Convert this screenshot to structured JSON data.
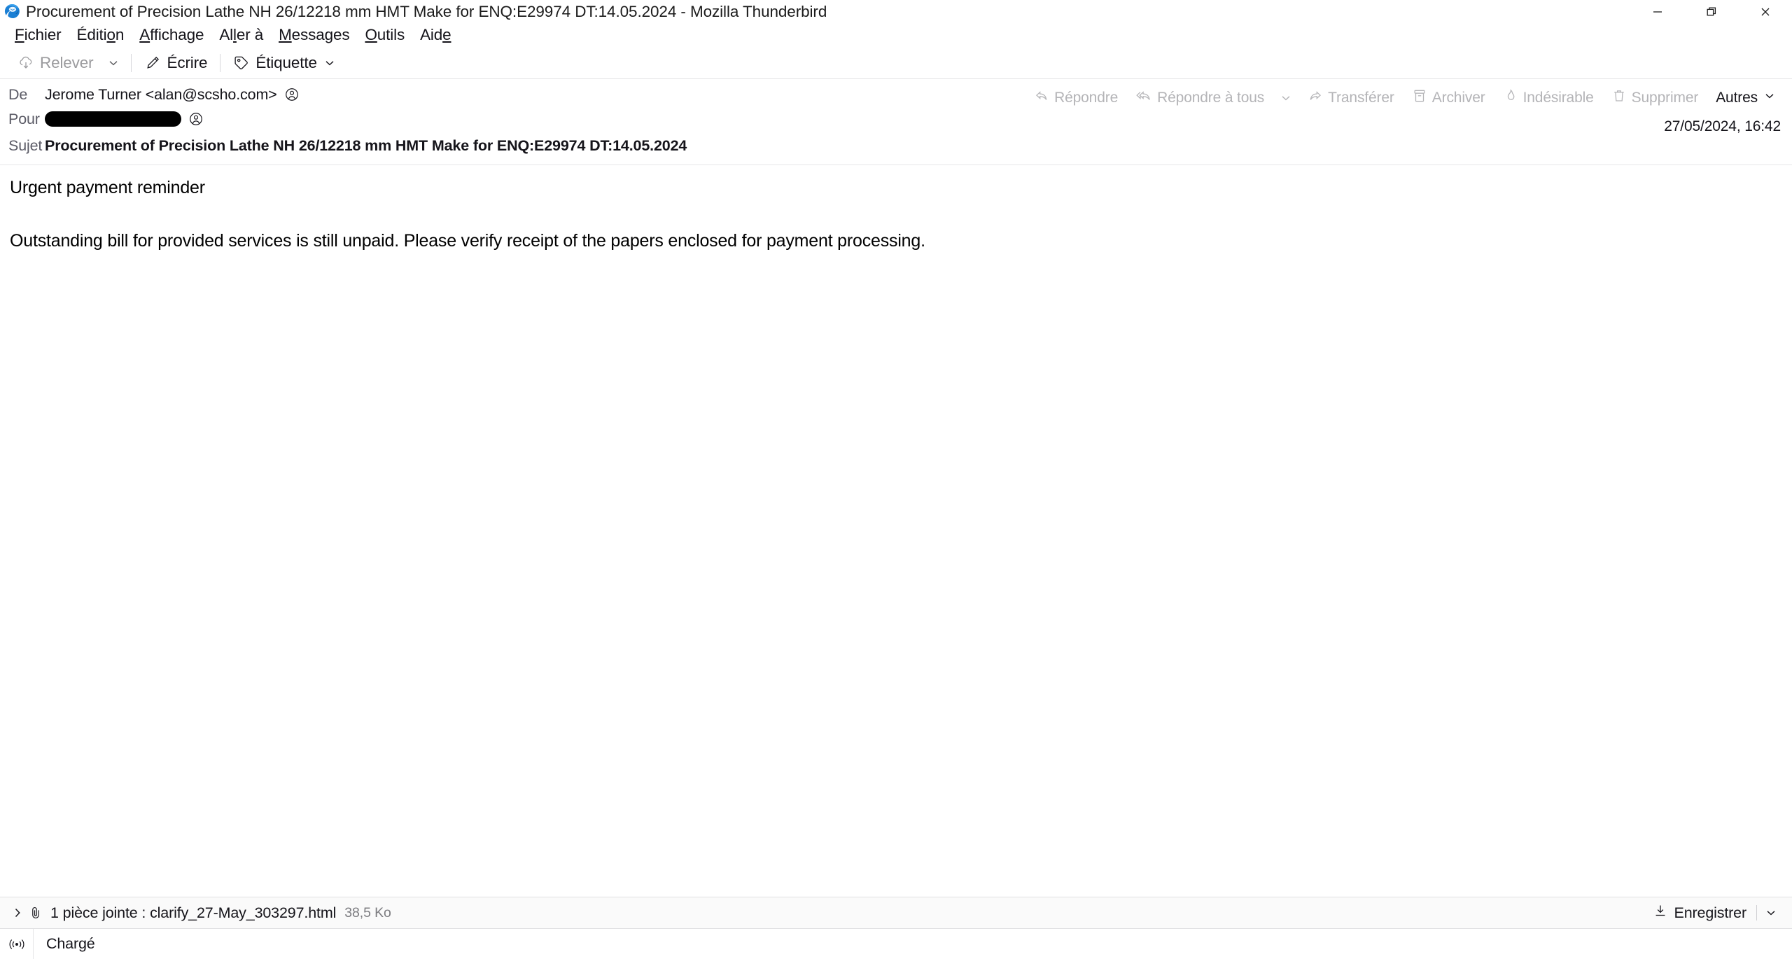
{
  "window": {
    "title": "Procurement of Precision Lathe NH 26/12218 mm HMT Make for ENQ:E29974 DT:14.05.2024 - Mozilla Thunderbird",
    "app_icon": "thunderbird-logo",
    "controls": {
      "minimize": "minimize-icon",
      "restore": "restore-icon",
      "close": "close-icon"
    }
  },
  "menubar": {
    "items": [
      {
        "label": "Fichier",
        "accel_index": 0
      },
      {
        "label": "Édition",
        "accel_index": 4
      },
      {
        "label": "Affichage",
        "accel_index": 0
      },
      {
        "label": "Aller à",
        "accel_index": 2
      },
      {
        "label": "Messages",
        "accel_index": 0
      },
      {
        "label": "Outils",
        "accel_index": 0
      },
      {
        "label": "Aide",
        "accel_index": 3
      }
    ]
  },
  "toolbar": {
    "get_messages_label": "Relever",
    "get_messages_icon": "cloud-download-icon",
    "get_messages_disabled": true,
    "get_messages_chevron": "chevron-down-icon",
    "write_label": "Écrire",
    "write_icon": "pencil-icon",
    "tag_label": "Étiquette",
    "tag_icon": "tag-icon",
    "tag_chevron": "chevron-down-icon"
  },
  "header": {
    "from_label": "De",
    "from_value": "Jerome Turner <alan@scsho.com>",
    "from_contact_icon": "contact-circle-icon",
    "to_label": "Pour",
    "to_value_redacted": true,
    "to_contact_icon": "contact-circle-icon",
    "subject_label": "Sujet",
    "subject_value": "Procurement of Precision Lathe NH 26/12218 mm HMT Make for ENQ:E29974 DT:14.05.2024",
    "date": "27/05/2024, 16:42"
  },
  "actions": {
    "reply_label": "Répondre",
    "reply_icon": "reply-icon",
    "reply_all_label": "Répondre à tous",
    "reply_all_icon": "reply-all-icon",
    "reply_all_chevron": "chevron-down-icon",
    "forward_label": "Transférer",
    "forward_icon": "forward-icon",
    "archive_label": "Archiver",
    "archive_icon": "archive-box-icon",
    "junk_label": "Indésirable",
    "junk_icon": "flame-icon",
    "delete_label": "Supprimer",
    "delete_icon": "trash-icon",
    "more_label": "Autres",
    "more_chevron": "chevron-down-icon"
  },
  "body": {
    "line1": "Urgent payment reminder",
    "line2": "Outstanding bill for provided services is still unpaid. Please verify receipt of the papers enclosed for payment processing."
  },
  "attachment": {
    "expand_icon": "chevron-right-icon",
    "paperclip_icon": "paperclip-icon",
    "text": "1 pièce jointe : clarify_27-May_303297.html",
    "size": "38,5 Ko",
    "save_label": "Enregistrer",
    "save_icon": "download-icon",
    "save_chevron": "chevron-down-icon"
  },
  "statusbar": {
    "connection_icon": "online-status-icon",
    "text": "Chargé"
  },
  "colors": {
    "accent": "#0a84ff",
    "text": "#15141a",
    "muted": "#5b5b66",
    "disabled": "#b4b4b7",
    "redaction": "#000000",
    "attach_bar_bg": "#fafafa"
  }
}
